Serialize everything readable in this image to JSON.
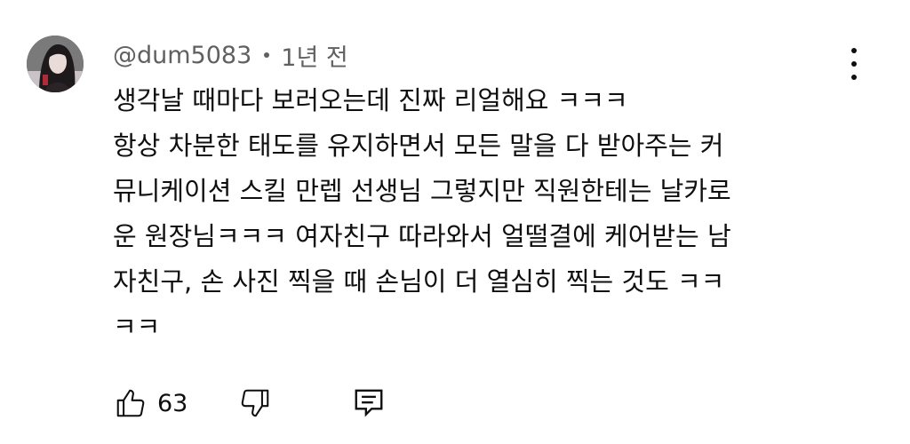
{
  "comment": {
    "author": "@dum5083",
    "time": "1년 전",
    "body_lines": [
      "생각날 때마다 보러오는데 진짜 리얼해요 ㅋㅋㅋ",
      "항상 차분한 태도를 유지하면서 모든 말을 다 받아주는 커",
      "뮤니케이션 스킬 만렙 선생님 그렇지만 직원한테는 날카로",
      "운 원장님ㅋㅋㅋ 여자친구 따라와서 얼떨결에 케어받는 남",
      "자친구, 손 사진 찍을 때 손님이 더 열심히 찍는 것도 ㅋㅋ",
      "ㅋㅋ"
    ],
    "likes": "63",
    "icons": {
      "avatar": "avatar",
      "more": "more-vert-icon",
      "like": "thumbs-up-icon",
      "dislike": "thumbs-down-icon",
      "reply": "reply-comment-icon"
    }
  },
  "colors": {
    "text_primary": "#0f0f0f",
    "text_secondary": "#606060",
    "background": "#ffffff"
  }
}
